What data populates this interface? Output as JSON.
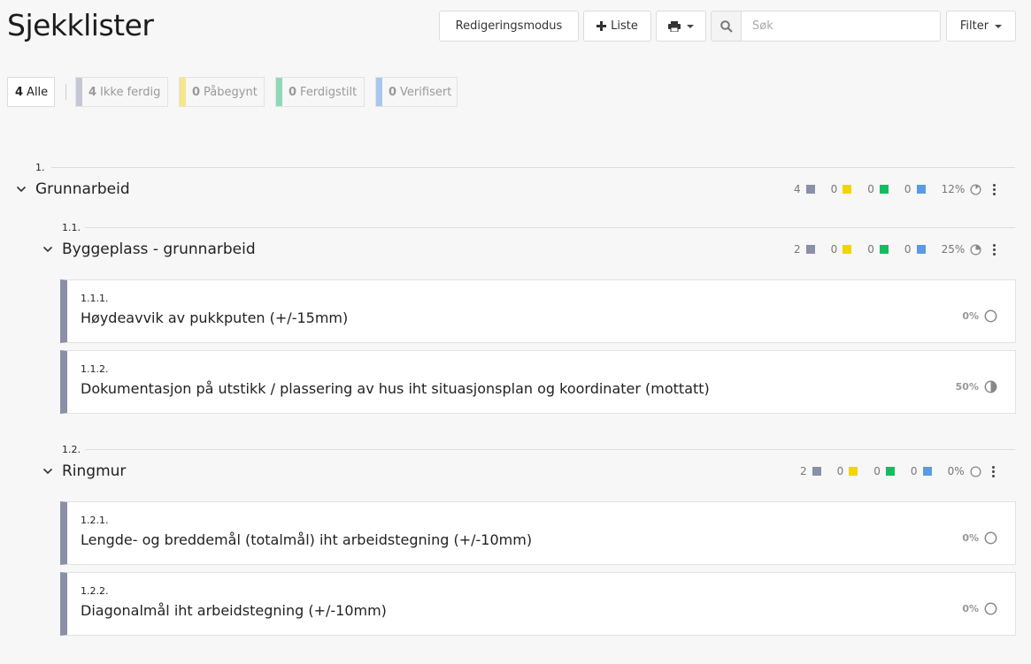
{
  "page": {
    "title": "Sjekklister"
  },
  "toolbar": {
    "edit_mode_label": "Redigeringsmodus",
    "add_list_label": "Liste",
    "search_placeholder": "Søk",
    "filter_label": "Filter"
  },
  "filters": [
    {
      "count": "4",
      "label": "Alle",
      "color": ""
    },
    {
      "count": "4",
      "label": "Ikke ferdig",
      "color": "#c5c8d4"
    },
    {
      "count": "0",
      "label": "Påbegynt",
      "color": "#f7e58c"
    },
    {
      "count": "0",
      "label": "Ferdigstilt",
      "color": "#8fd9b6"
    },
    {
      "count": "0",
      "label": "Verifisert",
      "color": "#a9c7ee"
    }
  ],
  "status_colors": {
    "not_done": "#8990a8",
    "started": "#f2d500",
    "done": "#0fbf5f",
    "verified": "#5b9be6"
  },
  "groups": [
    {
      "number": "1.",
      "title": "Grunnarbeid",
      "stats": [
        "4",
        "0",
        "0",
        "0"
      ],
      "percent": "12%",
      "progress": 0.12
    },
    {
      "number": "1.1.",
      "title": "Byggeplass - grunnarbeid",
      "stats": [
        "2",
        "0",
        "0",
        "0"
      ],
      "percent": "25%",
      "progress": 0.25
    },
    {
      "number": "1.2.",
      "title": "Ringmur",
      "stats": [
        "2",
        "0",
        "0",
        "0"
      ],
      "percent": "0%",
      "progress": 0
    }
  ],
  "items": [
    {
      "number": "1.1.1.",
      "title": "Høydeavvik av pukkputen (+/-15mm)",
      "percent": "0%",
      "progress": 0
    },
    {
      "number": "1.1.2.",
      "title": "Dokumentasjon på utstikk / plassering av hus iht situasjonsplan og koordinater (mottatt)",
      "percent": "50%",
      "progress": 0.5
    },
    {
      "number": "1.2.1.",
      "title": "Lengde- og breddemål (totalmål) iht arbeidstegning (+/-10mm)",
      "percent": "0%",
      "progress": 0
    },
    {
      "number": "1.2.2.",
      "title": "Diagonalmål iht arbeidstegning (+/-10mm)",
      "percent": "0%",
      "progress": 0
    }
  ]
}
